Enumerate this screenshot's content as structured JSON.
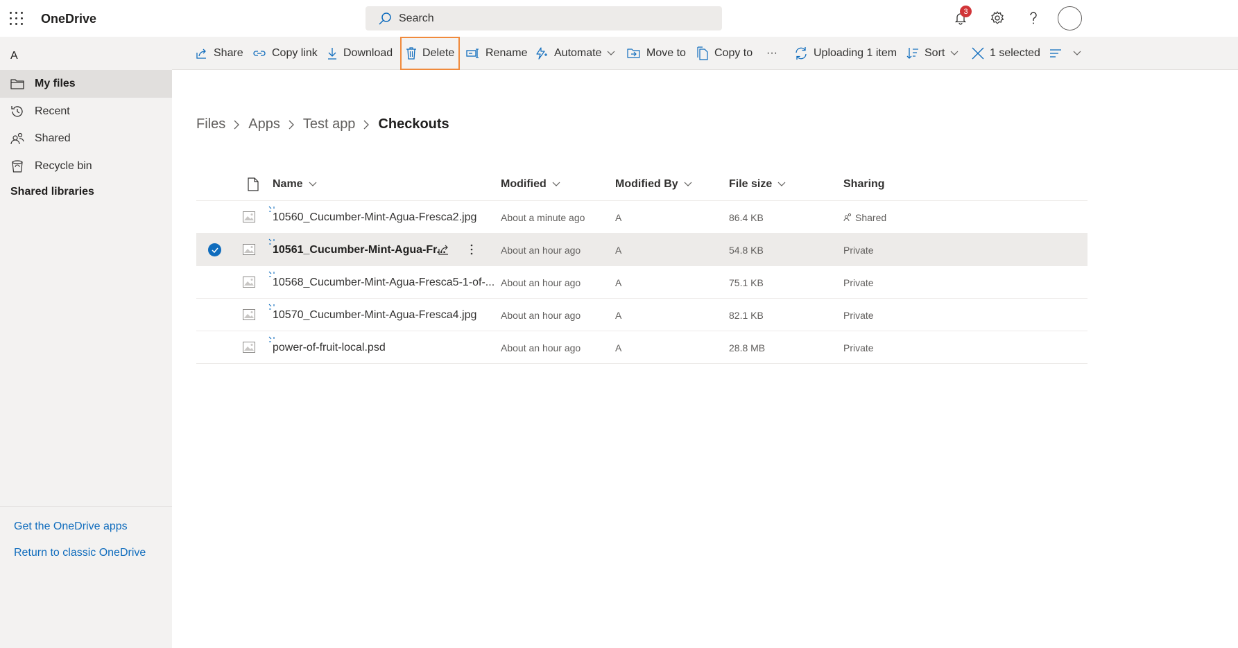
{
  "app": {
    "title": "OneDrive"
  },
  "search": {
    "placeholder": "Search"
  },
  "header": {
    "notification_count": "3"
  },
  "sidebar": {
    "user": "A",
    "items": [
      {
        "label": "My files",
        "icon": "folder-icon",
        "active": true
      },
      {
        "label": "Recent",
        "icon": "history-icon"
      },
      {
        "label": "Shared",
        "icon": "people-icon"
      },
      {
        "label": "Recycle bin",
        "icon": "recycle-bin-icon"
      }
    ],
    "shared_libraries": "Shared libraries",
    "footer_links": [
      "Get the OneDrive apps",
      "Return to classic OneDrive"
    ]
  },
  "toolbar": {
    "share": "Share",
    "copy_link": "Copy link",
    "download": "Download",
    "delete": "Delete",
    "rename": "Rename",
    "automate": "Automate",
    "move_to": "Move to",
    "copy_to": "Copy to",
    "more": "···",
    "uploading": "Uploading 1 item",
    "sort": "Sort",
    "selected": "1 selected"
  },
  "breadcrumb": [
    "Files",
    "Apps",
    "Test app",
    "Checkouts"
  ],
  "table": {
    "columns": {
      "name": "Name",
      "modified": "Modified",
      "modified_by": "Modified By",
      "file_size": "File size",
      "sharing": "Sharing"
    },
    "rows": [
      {
        "name": "10560_Cucumber-Mint-Agua-Fresca2.jpg",
        "modified": "About a minute ago",
        "modified_by": "A",
        "size": "86.4 KB",
        "sharing": "Shared",
        "selected": false
      },
      {
        "name": "10561_Cucumber-Mint-Agua-Fr...",
        "modified": "About an hour ago",
        "modified_by": "A",
        "size": "54.8 KB",
        "sharing": "Private",
        "selected": true
      },
      {
        "name": "10568_Cucumber-Mint-Agua-Fresca5-1-of-...",
        "modified": "About an hour ago",
        "modified_by": "A",
        "size": "75.1 KB",
        "sharing": "Private",
        "selected": false
      },
      {
        "name": "10570_Cucumber-Mint-Agua-Fresca4.jpg",
        "modified": "About an hour ago",
        "modified_by": "A",
        "size": "82.1 KB",
        "sharing": "Private",
        "selected": false
      },
      {
        "name": "power-of-fruit-local.psd",
        "modified": "About an hour ago",
        "modified_by": "A",
        "size": "28.8 MB",
        "sharing": "Private",
        "selected": false
      }
    ]
  },
  "colors": {
    "accent": "#0f6cbd",
    "highlight": "#f08a3c",
    "badge": "#d13438"
  }
}
